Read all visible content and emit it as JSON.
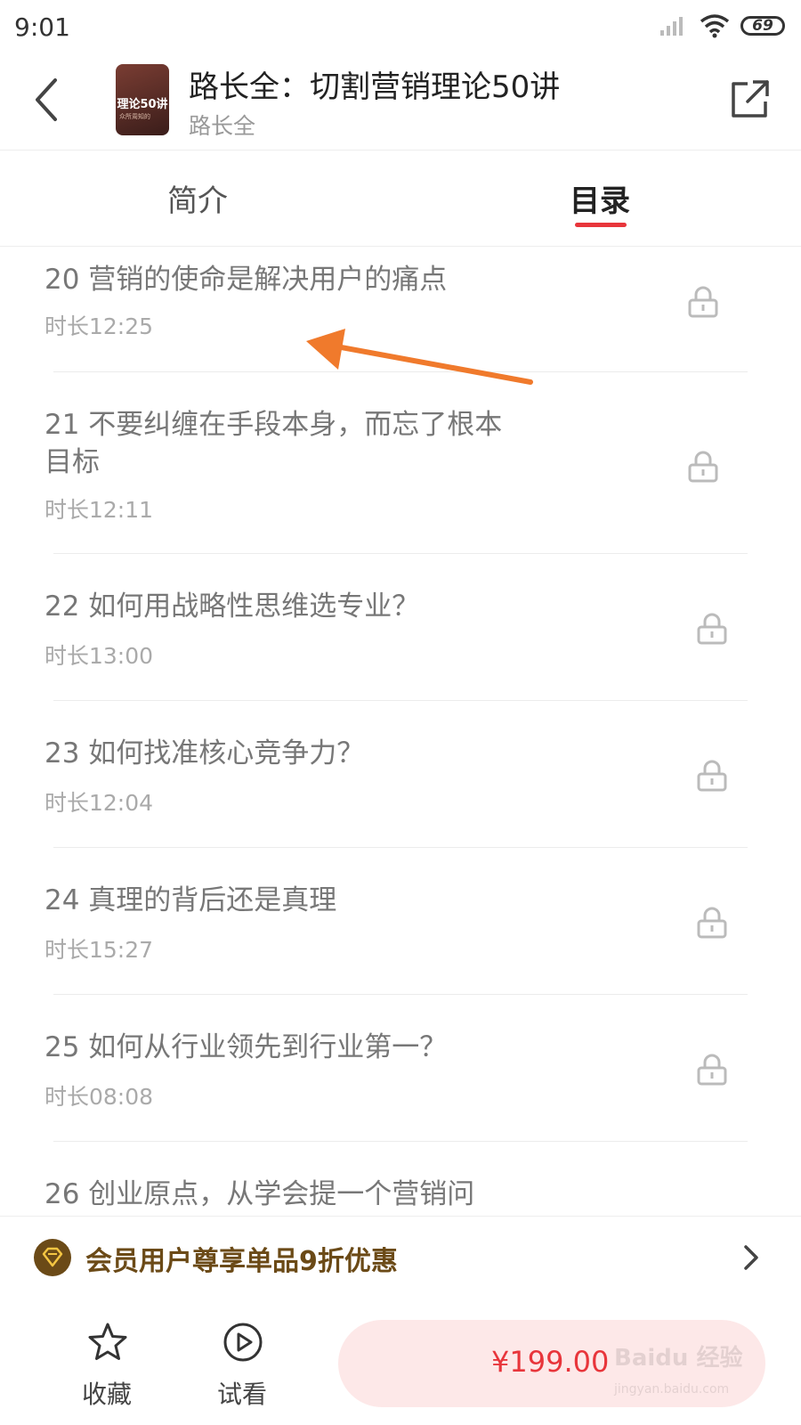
{
  "status_bar": {
    "time": "9:01",
    "battery": "69"
  },
  "header": {
    "title": "路长全：切割营销理论50讲",
    "author": "路长全",
    "cover_text": "理论50讲",
    "cover_subtext": "众所周知的"
  },
  "tabs": [
    {
      "label": "简介",
      "active": false
    },
    {
      "label": "目录",
      "active": true
    }
  ],
  "lessons": [
    {
      "title": "20 营销的使命是解决用户的痛点",
      "duration": "时长12:25",
      "locked": true
    },
    {
      "title": "21 不要纠缠在手段本身，而忘了根本目标",
      "duration": "时长12:11",
      "locked": true
    },
    {
      "title": "22 如何用战略性思维选专业？",
      "duration": "时长13:00",
      "locked": true
    },
    {
      "title": "23 如何找准核心竞争力？",
      "duration": "时长12:04",
      "locked": true
    },
    {
      "title": "24 真理的背后还是真理",
      "duration": "时长15:27",
      "locked": true
    },
    {
      "title": "25 如何从行业领先到行业第一？",
      "duration": "时长08:08",
      "locked": true
    },
    {
      "title": "26 创业原点，从学会提一个营销问",
      "duration": "",
      "locked": true
    }
  ],
  "vip_banner": {
    "text": "会员用户尊享单品9折优惠"
  },
  "bottom_bar": {
    "favorite_label": "收藏",
    "trial_label": "试看",
    "price": "¥199.00"
  },
  "watermark": {
    "text": "Baidu 经验",
    "subtext": "jingyan.baidu.com"
  },
  "colors": {
    "accent": "#e8353b",
    "vip": "#6b4a17",
    "annotation": "#f07a2c"
  }
}
